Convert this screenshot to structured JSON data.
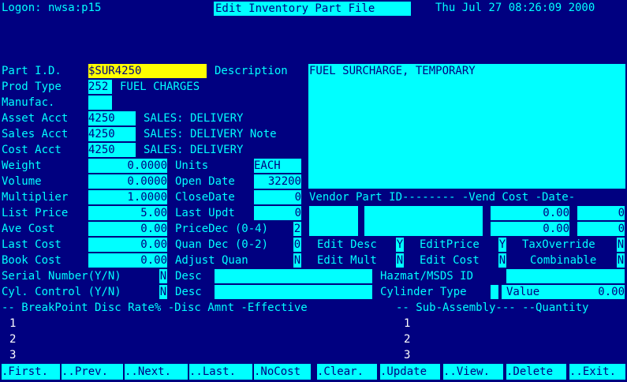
{
  "header": {
    "logon": "Logon: nwsa:p15",
    "title": "Edit Inventory Part File",
    "datetime": "Thu Jul 27 08:26:09 2000"
  },
  "labels": {
    "part_id": "Part I.D.",
    "description": "Description",
    "prod_type": "Prod Type",
    "manufac": "Manufac.",
    "asset_acct": "Asset Acct",
    "sales_acct": "Sales Acct",
    "cost_acct": "Cost Acct",
    "weight": "Weight",
    "volume": "Volume",
    "multiplier": "Multiplier",
    "list_price": "List Price",
    "ave_cost": "Ave Cost",
    "last_cost": "Last Cost",
    "book_cost": "Book Cost",
    "units": "Units",
    "open_date": "Open Date",
    "close_date": "CloseDate",
    "last_updt": "Last Updt",
    "price_dec": "PriceDec (0-4)",
    "quan_dec": "Quan Dec (0-2)",
    "adjust_quan": "Adjust Quan",
    "vendor_header": "Vendor Part ID-------- -Vend Cost -Date-",
    "edit_desc": "Edit Desc",
    "edit_price": "EditPrice",
    "tax_override": "TaxOverride",
    "edit_mult": "Edit Mult",
    "edit_cost": "Edit Cost",
    "combinable": "Combinable",
    "serial_number": "Serial Number(Y/N)",
    "cyl_control": "Cyl. Control (Y/N)",
    "desc": "Desc",
    "hazmat": "Hazmat/MSDS ID",
    "cylinder_type": "Cylinder Type",
    "value": "Value",
    "breakpoint_header": "-- BreakPoint Disc Rate% -Disc Amnt -Effective",
    "subassembly_header": "-- Sub-Assembly--- --Quantity"
  },
  "fields": {
    "part_id": "$SUR4250",
    "description": "FUEL SURCHARGE, TEMPORARY",
    "prod_type_code": "252",
    "prod_type_name": "FUEL CHARGES",
    "manufac": "",
    "asset_acct": "4250",
    "asset_acct_name": "SALES: DELIVERY",
    "sales_acct": "4250",
    "sales_acct_name": "SALES: DELIVERY Note",
    "cost_acct": "4250",
    "cost_acct_name": "SALES: DELIVERY",
    "weight": "0.0000",
    "volume": "0.0000",
    "multiplier": "1.0000",
    "list_price": "5.00",
    "ave_cost": "0.00",
    "last_cost": "0.00",
    "book_cost": "0.00",
    "units": "EACH",
    "open_date": "32200",
    "close_date": "0",
    "last_updt": "0",
    "price_dec": "2",
    "quan_dec": "0",
    "adjust_quan": "N",
    "vend_cost_1": "0.00",
    "vend_date_1": "0",
    "vend_cost_2": "0.00",
    "vend_date_2": "0",
    "edit_desc": "Y",
    "edit_price": "Y",
    "tax_override": "N",
    "edit_mult": "N",
    "edit_cost": "N",
    "combinable": "N",
    "serial_number": "N",
    "cyl_control": "N",
    "serial_desc": "",
    "cyl_desc": "",
    "hazmat": "",
    "cylinder_type": "",
    "value": "0.00"
  },
  "breakpoint_rows": [
    "1",
    "2",
    "3"
  ],
  "subassembly_rows": [
    "1",
    "2",
    "3"
  ],
  "toolbar": {
    "first": ".First.",
    "prev": "..Prev.",
    "next": "..Next.",
    "last": "..Last.",
    "nocost": ".NoCost",
    "clear": ".Clear.",
    "update": ".Update",
    "view": "..View.",
    "delete": ".Delete",
    "exit": "..Exit."
  },
  "colors": {
    "background": "#000080",
    "field": "#00ffff",
    "selected": "#ffff00"
  }
}
